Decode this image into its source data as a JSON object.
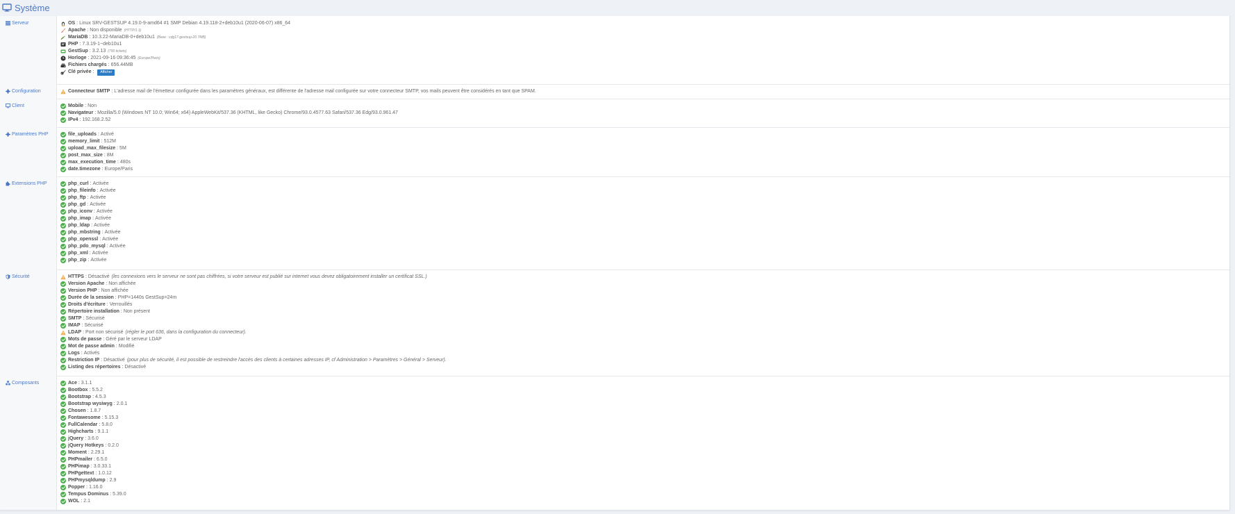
{
  "page": {
    "title": "Système"
  },
  "sections": {
    "serveur": {
      "label": "Serveur",
      "rows": [
        {
          "key": "OS",
          "value": "Linux SRV-GESTSUP 4.19.0-9-amd64 #1 SMP Debian 4.19.118-2+deb10u1 (2020-06-07) x86_64",
          "icon": "linux-icon"
        },
        {
          "key": "Apache",
          "value": "Non disponible",
          "note": "(HTTP/1.1)",
          "icon": "apache-feather-icon"
        },
        {
          "key": "MariaDB",
          "value": "10.3.22-MariaDB-0+deb10u1",
          "note": "(Base : cdg17-gestsup-20 7MB)",
          "icon": "mariadb-icon"
        },
        {
          "key": "PHP",
          "value": "7.3.19-1~deb10u1",
          "icon": "php-icon"
        },
        {
          "key": "GestSup",
          "value": "3.2.13",
          "note": "(790 tickets)",
          "icon": "gestsup-icon"
        },
        {
          "key": "Horloge",
          "value": "2021-09-16 09:36:45",
          "note": "(Europe/Paris)",
          "icon": "clock-icon"
        },
        {
          "key": "Fichiers chargés",
          "value": "656.44MB",
          "icon": "hdd-icon"
        },
        {
          "key": "Clé privée",
          "value": "",
          "button": "Afficher",
          "icon": "key-icon"
        }
      ]
    },
    "configuration": {
      "label": "Configuration",
      "rows": [
        {
          "key": "Connecteur SMTP",
          "value": "L'adresse mail de l'émetteur configurée dans les paramètres généraux, est différente de l'adresse mail configurée sur votre connecteur SMTP, vos mails peuvent être considérés en tant que SPAM.",
          "icon": "warning-icon"
        }
      ]
    },
    "client": {
      "label": "Client",
      "rows": [
        {
          "key": "Mobile",
          "value": "Non",
          "icon": "check-icon"
        },
        {
          "key": "Navigateur",
          "value": "Mozilla/5.0 (Windows NT 10.0; Win64; x64) AppleWebKit/537.36 (KHTML, like Gecko) Chrome/93.0.4577.63 Safari/537.36 Edg/93.0.961.47",
          "icon": "check-icon"
        },
        {
          "key": "IPv4",
          "value": "192.168.2.52",
          "icon": "check-icon"
        }
      ]
    },
    "parametres_php": {
      "label": "Paramètres PHP",
      "rows": [
        {
          "key": "file_uploads",
          "value": "Activé",
          "icon": "check-icon"
        },
        {
          "key": "memory_limit",
          "value": "512M",
          "icon": "check-icon"
        },
        {
          "key": "upload_max_filesize",
          "value": "5M",
          "icon": "check-icon"
        },
        {
          "key": "post_max_size",
          "value": "8M",
          "icon": "check-icon"
        },
        {
          "key": "max_execution_time",
          "value": "480s",
          "icon": "check-icon"
        },
        {
          "key": "date.timezone",
          "value": "Europe/Paris",
          "icon": "check-icon"
        }
      ]
    },
    "extensions_php": {
      "label": "Extensions PHP",
      "rows": [
        {
          "key": "php_curl",
          "value": "Activée",
          "icon": "check-icon"
        },
        {
          "key": "php_fileinfo",
          "value": "Activée",
          "icon": "check-icon"
        },
        {
          "key": "php_ftp",
          "value": "Activée",
          "icon": "check-icon"
        },
        {
          "key": "php_gd",
          "value": "Activée",
          "icon": "check-icon"
        },
        {
          "key": "php_iconv",
          "value": "Activée",
          "icon": "check-icon"
        },
        {
          "key": "php_imap",
          "value": "Activée",
          "icon": "check-icon"
        },
        {
          "key": "php_ldap",
          "value": "Activée",
          "icon": "check-icon"
        },
        {
          "key": "php_mbstring",
          "value": "Activée",
          "icon": "check-icon"
        },
        {
          "key": "php_openssl",
          "value": "Activée",
          "icon": "check-icon"
        },
        {
          "key": "php_pdo_mysql",
          "value": "Activée",
          "icon": "check-icon"
        },
        {
          "key": "php_xml",
          "value": "Activée",
          "icon": "check-icon"
        },
        {
          "key": "php_zip",
          "value": "Activée",
          "icon": "check-icon"
        }
      ]
    },
    "securite": {
      "label": "Sécurité",
      "rows": [
        {
          "key": "HTTPS",
          "value": "Désactivé",
          "note": "(les connexions vers le serveur ne sont pas chiffrées, si votre serveur est publié sur internet vous devez obligatoirement installer un certificat SSL.)",
          "icon": "warning-icon"
        },
        {
          "key": "Version Apache",
          "value": "Non affichée",
          "icon": "check-icon"
        },
        {
          "key": "Version PHP",
          "value": "Non affichée",
          "icon": "check-icon"
        },
        {
          "key": "Durée de la session",
          "value": "PHP=1440s GestSup=24m",
          "icon": "check-icon"
        },
        {
          "key": "Droits d'écriture",
          "value": "Verrouillés",
          "icon": "check-icon"
        },
        {
          "key": "Répertoire installation",
          "value": "Non présent",
          "icon": "check-icon"
        },
        {
          "key": "SMTP",
          "value": "Sécurisé",
          "icon": "check-icon"
        },
        {
          "key": "IMAP",
          "value": "Sécurisé",
          "icon": "check-icon"
        },
        {
          "key": "LDAP",
          "value": "Port non sécurisé",
          "note": "(régler le port 636, dans la configuration du connecteur).",
          "icon": "warning-icon"
        },
        {
          "key": "Mots de passe",
          "value": "Géré par le serveur LDAP",
          "icon": "check-icon"
        },
        {
          "key": "Mot de passe admin",
          "value": "Modifié",
          "icon": "check-icon"
        },
        {
          "key": "Logs",
          "value": "Activés",
          "icon": "check-icon"
        },
        {
          "key": "Restriction IP",
          "value": "Désactivé",
          "note": "(pour plus de sécurité, il est possible de restreindre l'accès des clients à certaines adresses IP, cf Administration > Paramètres > Général > Serveur).",
          "icon": "check-icon"
        },
        {
          "key": "Listing des répertoires",
          "value": "Désactivé",
          "icon": "check-icon"
        }
      ]
    },
    "composants": {
      "label": "Composants",
      "rows": [
        {
          "key": "Ace",
          "value": "3.1.1",
          "icon": "check-icon"
        },
        {
          "key": "Bootbox",
          "value": "5.5.2",
          "icon": "check-icon"
        },
        {
          "key": "Bootstrap",
          "value": "4.5.3",
          "icon": "check-icon"
        },
        {
          "key": "Bootstrap wysiwyg",
          "value": "2.0.1",
          "icon": "check-icon"
        },
        {
          "key": "Chosen",
          "value": "1.8.7",
          "icon": "check-icon"
        },
        {
          "key": "Fontawesome",
          "value": "5.15.3",
          "icon": "check-icon"
        },
        {
          "key": "FullCalendar",
          "value": "5.8.0",
          "icon": "check-icon"
        },
        {
          "key": "Highcharts",
          "value": "9.1.1",
          "icon": "check-icon"
        },
        {
          "key": "jQuery",
          "value": "3.6.0",
          "icon": "check-icon"
        },
        {
          "key": "jQuery Hotkeys",
          "value": "0.2.0",
          "icon": "check-icon"
        },
        {
          "key": "Moment",
          "value": "2.29.1",
          "icon": "check-icon"
        },
        {
          "key": "PHPmailer",
          "value": "6.5.0",
          "icon": "check-icon"
        },
        {
          "key": "PHPimap",
          "value": "3.0.33.1",
          "icon": "check-icon"
        },
        {
          "key": "PHPgettext",
          "value": "1.0.12",
          "icon": "check-icon"
        },
        {
          "key": "PHPmysqldump",
          "value": "2.9",
          "icon": "check-icon"
        },
        {
          "key": "Popper",
          "value": "1.16.0",
          "icon": "check-icon"
        },
        {
          "key": "Tempus Dominus",
          "value": "5.39.0",
          "icon": "check-icon"
        },
        {
          "key": "WOL",
          "value": "2.1",
          "icon": "check-icon"
        }
      ]
    }
  },
  "colors": {
    "accent": "#4e79c4",
    "ok": "#4cae4c",
    "warn": "#f0ad4e",
    "button": "#2b7bc6"
  }
}
